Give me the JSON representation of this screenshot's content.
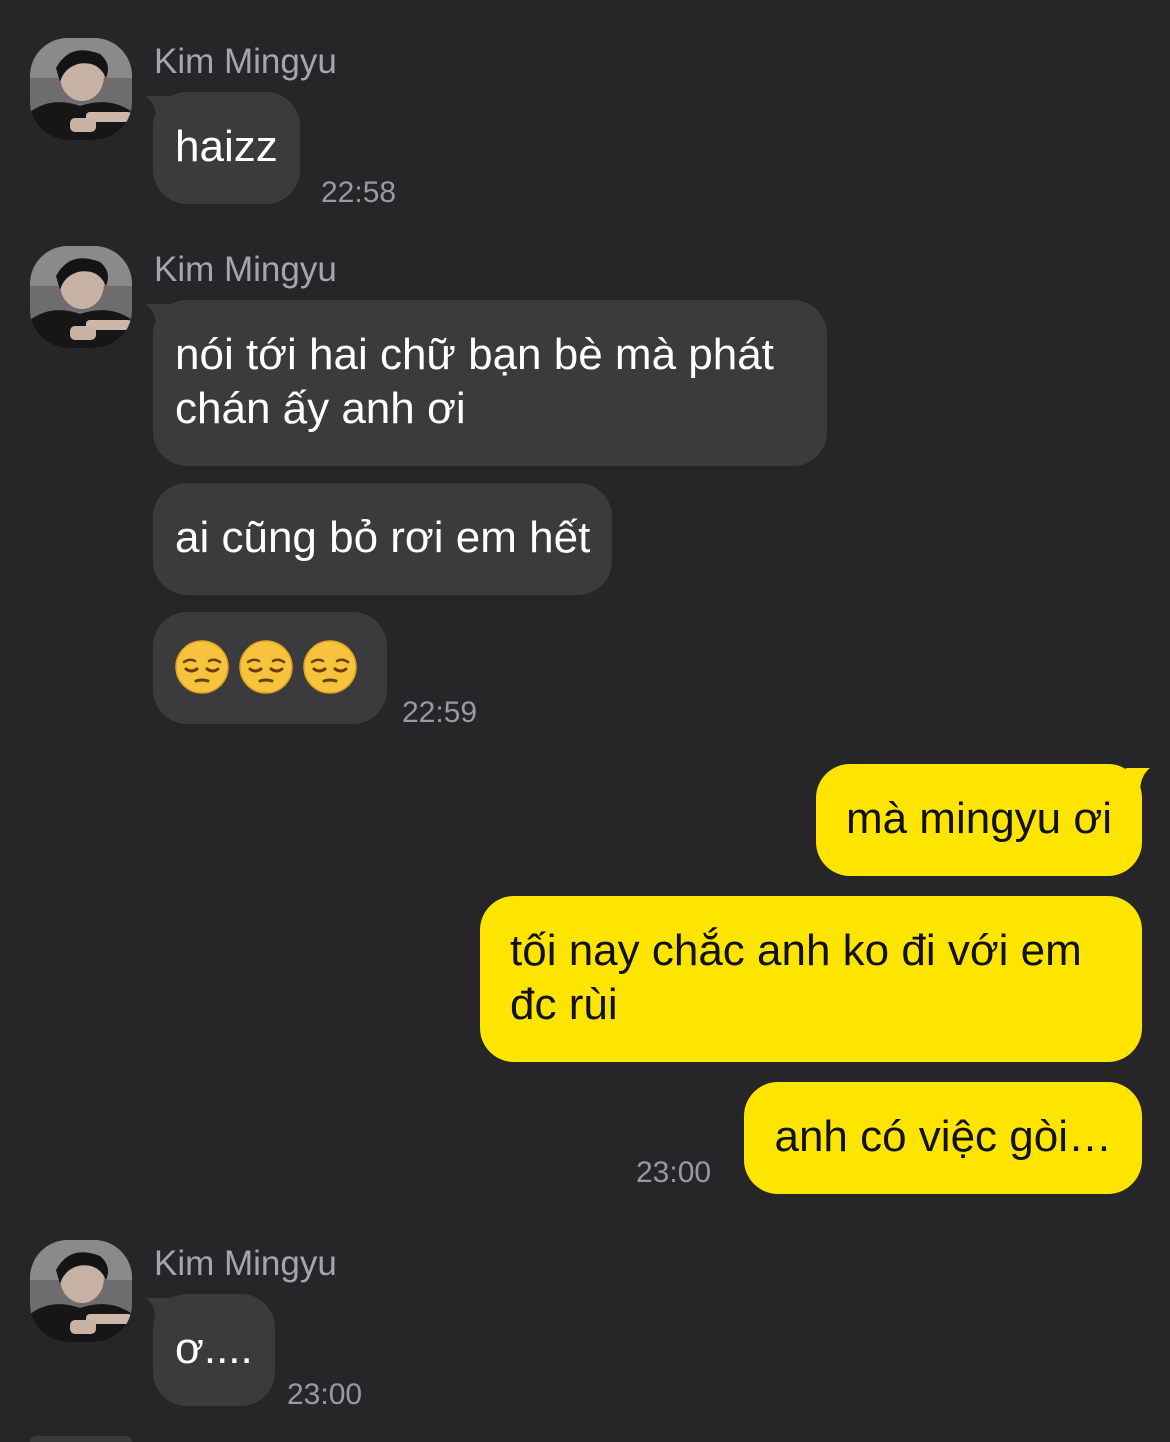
{
  "contact": {
    "name": "Kim Mingyu"
  },
  "messages": {
    "group1": {
      "sender": "Kim Mingyu",
      "bubble1": "haizz",
      "time": "22:58"
    },
    "group2": {
      "sender": "Kim Mingyu",
      "bubble1": "nói tới hai chữ bạn bè mà phát chán ấy anh ơi",
      "bubble2": "ai cũng bỏ rơi em hết",
      "bubble3_emoji": [
        "pensive-face",
        "pensive-face",
        "pensive-face"
      ],
      "time": "22:59"
    },
    "group3": {
      "bubble1": "mà mingyu ơi",
      "bubble2": "tối nay chắc anh ko đi với em đc rùi",
      "bubble3": "anh có việc gòi…",
      "time": "23:00"
    },
    "group4": {
      "sender": "Kim Mingyu",
      "bubble1": "ơ....",
      "time": "23:00"
    }
  },
  "colors": {
    "background": "#262628",
    "incoming_bubble": "#3b3b3e",
    "outgoing_bubble": "#fee500",
    "meta_text": "#a6a6aa"
  }
}
